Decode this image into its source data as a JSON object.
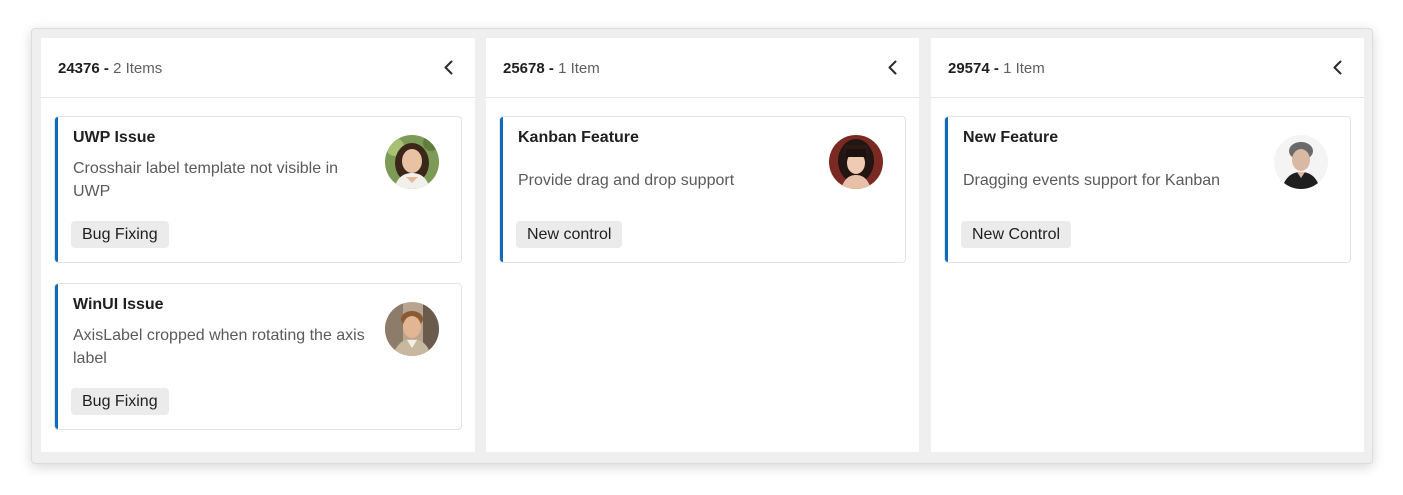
{
  "columns": [
    {
      "key": "24376",
      "separator": "-",
      "count": "2 Items",
      "cards": [
        {
          "title": "UWP Issue",
          "description": "Crosshair label template not visible in UWP",
          "tag": "Bug Fixing",
          "avatar": "woman-portrait"
        },
        {
          "title": "WinUI Issue",
          "description": "AxisLabel cropped when rotating the axis label",
          "tag": "Bug Fixing",
          "avatar": "man-portrait"
        }
      ]
    },
    {
      "key": "25678",
      "separator": "-",
      "count": "1 Item",
      "cards": [
        {
          "title": "Kanban Feature",
          "description": "Provide drag and drop support",
          "tag": "New control",
          "avatar": "woman-portrait"
        }
      ]
    },
    {
      "key": "29574",
      "separator": "-",
      "count": "1 Item",
      "cards": [
        {
          "title": "New Feature",
          "description": "Dragging events support for Kanban",
          "tag": "New Control",
          "avatar": "man-portrait"
        }
      ]
    }
  ],
  "colors": {
    "accent": "#0f6cbd",
    "board_background": "#efefef",
    "column_background": "#ffffff",
    "tag_background": "#ebebeb"
  },
  "icons": {
    "collapse": "chevron-left-icon"
  }
}
